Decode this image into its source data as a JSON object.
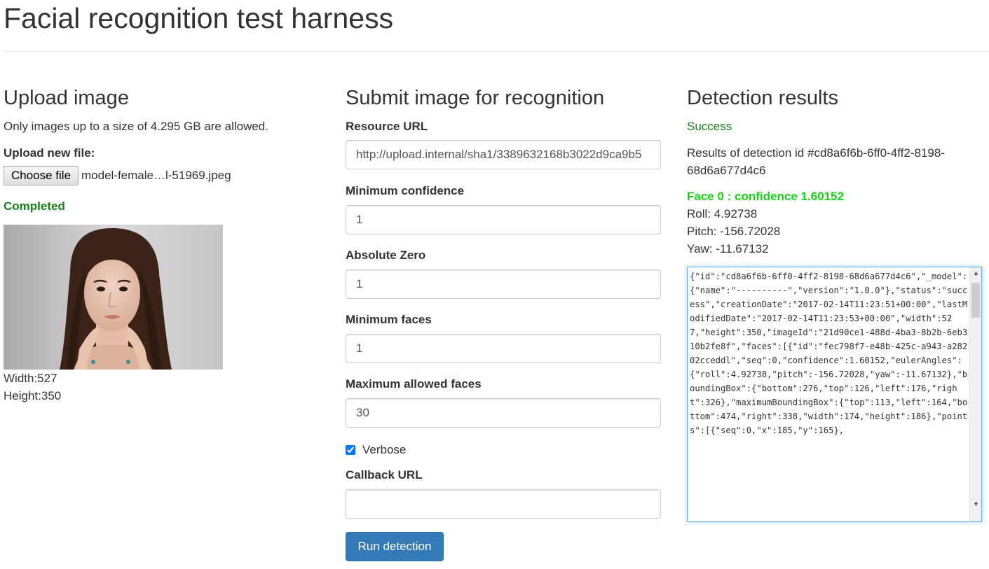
{
  "page": {
    "title": "Facial recognition test harness"
  },
  "upload": {
    "heading": "Upload image",
    "size_note": "Only images up to a size of 4.295 GB are allowed.",
    "file_label": "Upload new file:",
    "choose_button": "Choose file",
    "file_name": "model-female…l-51969.jpeg",
    "status": "Completed",
    "width_text": "Width:527",
    "height_text": "Height:350"
  },
  "submit": {
    "heading": "Submit image for recognition",
    "fields": [
      {
        "label": "Resource URL",
        "value": "http://upload.internal/sha1/3389632168b3022d9ca9b5"
      },
      {
        "label": "Minimum confidence",
        "value": "1"
      },
      {
        "label": "Absolute Zero",
        "value": "1"
      },
      {
        "label": "Minimum faces",
        "value": "1"
      },
      {
        "label": "Maximum allowed faces",
        "value": "30"
      }
    ],
    "verbose": {
      "label": "Verbose",
      "checked": true
    },
    "callback": {
      "label": "Callback URL",
      "value": ""
    },
    "run_button": "Run detection"
  },
  "results": {
    "heading": "Detection results",
    "status": "Success",
    "detection_line1": "Results of detection id #cd8a6f6b-6ff0-4ff2-8198-",
    "detection_line2": "68d6a677d4c6",
    "face_header": "Face 0 : confidence 1.60152",
    "roll": "Roll: 4.92738",
    "pitch": "Pitch: -156.72028",
    "yaw": "Yaw: -11.67132",
    "json": "{\"id\":\"cd8a6f6b-6ff0-4ff2-8198-68d6a677d4c6\",\"_model\":{\"name\":\"----------\",\"version\":\"1.0.0\"},\"status\":\"success\",\"creationDate\":\"2017-02-14T11:23:51+00:00\",\"lastModifiedDate\":\"2017-02-14T11:23:53+00:00\",\"width\":527,\"height\":350,\"imageId\":\"21d90ce1-488d-4ba3-8b2b-6eb310b2fe8f\",\"faces\":[{\"id\":\"fec798f7-e48b-425c-a943-a28202cceddl\",\"seq\":0,\"confidence\":1.60152,\"eulerAngles\":{\"roll\":4.92738,\"pitch\":-156.72028,\"yaw\":-11.67132},\"boundingBox\":{\"bottom\":276,\"top\":126,\"left\":176,\"right\":326},\"maximumBoundingBox\":{\"top\":113,\"left\":164,\"bottom\":474,\"right\":338,\"width\":174,\"height\":186},\"points\":[{\"seq\":0,\"x\":185,\"y\":165},"
  },
  "colors": {
    "primary": "#337ab7",
    "success": "#1a7f1a",
    "face_highlight": "#14d414"
  }
}
